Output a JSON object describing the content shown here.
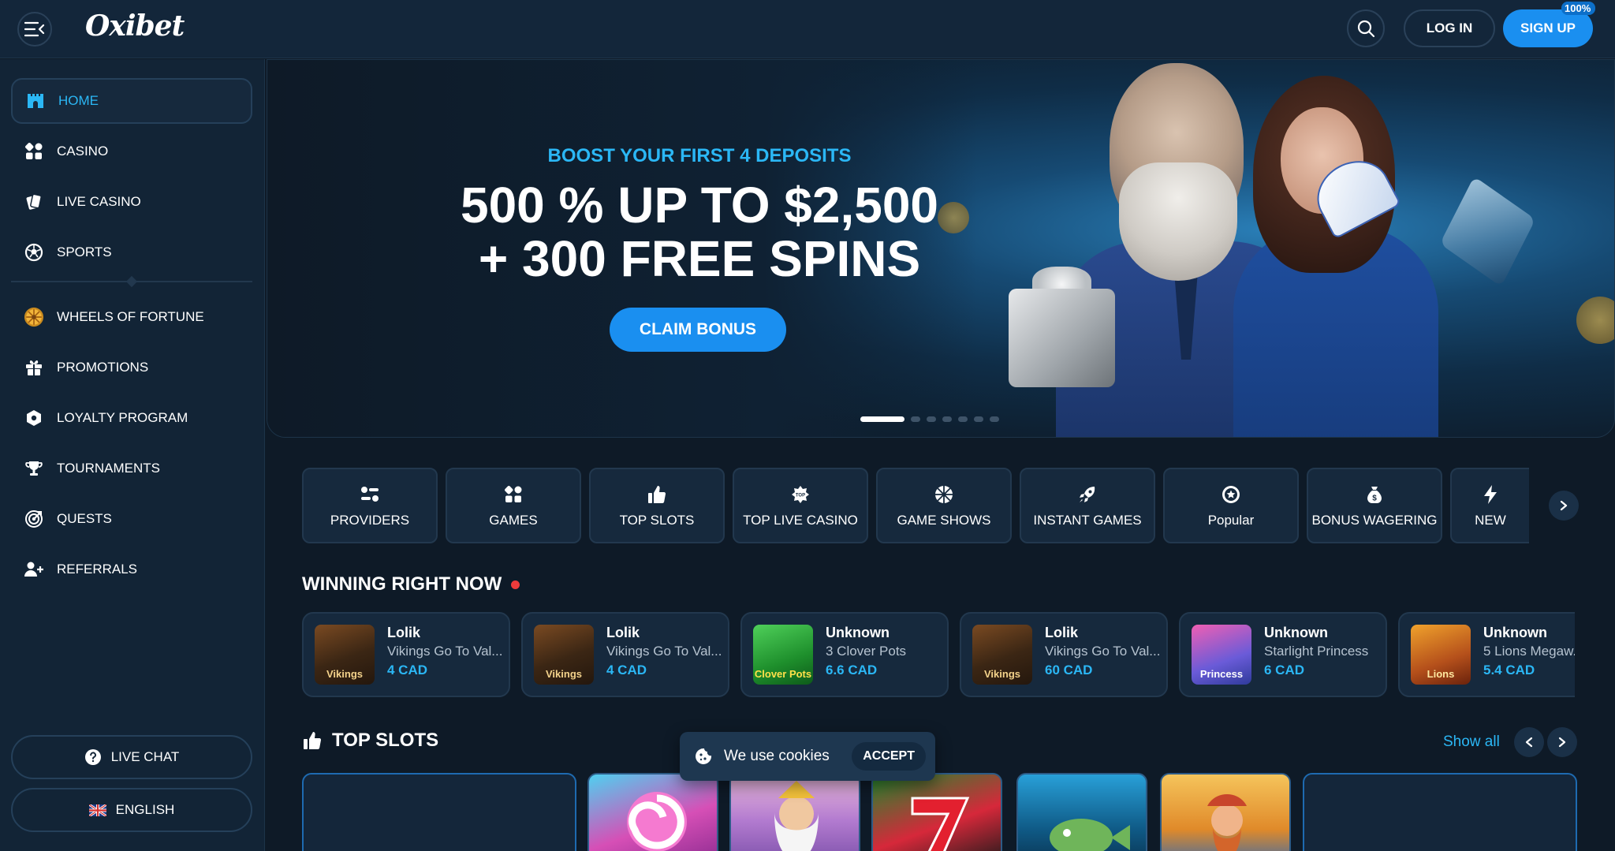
{
  "header": {
    "logo": "Oxibet",
    "login": "LOG IN",
    "signup": "SIGN UP",
    "zoom": "100%"
  },
  "sidebar": {
    "items": [
      {
        "label": "HOME",
        "icon": "castle-icon",
        "active": true
      },
      {
        "label": "CASINO",
        "icon": "grid-icon"
      },
      {
        "label": "LIVE CASINO",
        "icon": "cards-icon"
      },
      {
        "label": "SPORTS",
        "icon": "soccer-ball-icon"
      },
      {
        "label": "WHEELS OF FORTUNE",
        "icon": "wheel-icon"
      },
      {
        "label": "PROMOTIONS",
        "icon": "gift-icon"
      },
      {
        "label": "LOYALTY PROGRAM",
        "icon": "shield-icon"
      },
      {
        "label": "TOURNAMENTS",
        "icon": "trophy-icon"
      },
      {
        "label": "QUESTS",
        "icon": "target-icon"
      },
      {
        "label": "REFERRALS",
        "icon": "add-user-icon"
      }
    ],
    "live_chat": "LIVE CHAT",
    "language": "ENGLISH"
  },
  "hero": {
    "subtitle": "BOOST YOUR FIRST 4 DEPOSITS",
    "title_line1": "500 % UP TO $2,500",
    "title_line2": "+ 300 FREE SPINS",
    "cta": "CLAIM BONUS",
    "slides": 7,
    "active_slide": 1
  },
  "categories": [
    {
      "label": "PROVIDERS",
      "icon": "filters-icon"
    },
    {
      "label": "GAMES",
      "icon": "grid-icon"
    },
    {
      "label": "TOP SLOTS",
      "icon": "thumbs-up-icon"
    },
    {
      "label": "TOP LIVE CASINO",
      "icon": "top-badge-icon"
    },
    {
      "label": "GAME SHOWS",
      "icon": "wheel-icon"
    },
    {
      "label": "INSTANT GAMES",
      "icon": "rocket-icon"
    },
    {
      "label": "Popular",
      "icon": "star-badge-icon"
    },
    {
      "label": "BONUS WAGERING",
      "icon": "money-bag-icon"
    },
    {
      "label": "NEW",
      "icon": "lightning-icon"
    }
  ],
  "winning": {
    "title": "WINNING RIGHT NOW",
    "items": [
      {
        "user": "Lolik",
        "game": "Vikings Go To Val...",
        "amount": "4 CAD",
        "thumb": "Vikings"
      },
      {
        "user": "Lolik",
        "game": "Vikings Go To Val...",
        "amount": "4 CAD",
        "thumb": "Vikings"
      },
      {
        "user": "Unknown",
        "game": "3 Clover Pots",
        "amount": "6.6 CAD",
        "thumb": "Clover Pots"
      },
      {
        "user": "Lolik",
        "game": "Vikings Go To Val...",
        "amount": "60 CAD",
        "thumb": "Vikings"
      },
      {
        "user": "Unknown",
        "game": "Starlight Princess",
        "amount": "6 CAD",
        "thumb": "Princess"
      },
      {
        "user": "Unknown",
        "game": "5 Lions Megaw...",
        "amount": "5.4 CAD",
        "thumb": "Lions"
      }
    ]
  },
  "top_slots": {
    "title": "TOP SLOTS",
    "show_all": "Show all"
  },
  "cookie": {
    "text": "We use cookies",
    "accept": "ACCEPT"
  },
  "colors": {
    "accent": "#2bb7f5",
    "button": "#1a8ff0",
    "background": "#0e1a27",
    "panel": "#16293d"
  }
}
